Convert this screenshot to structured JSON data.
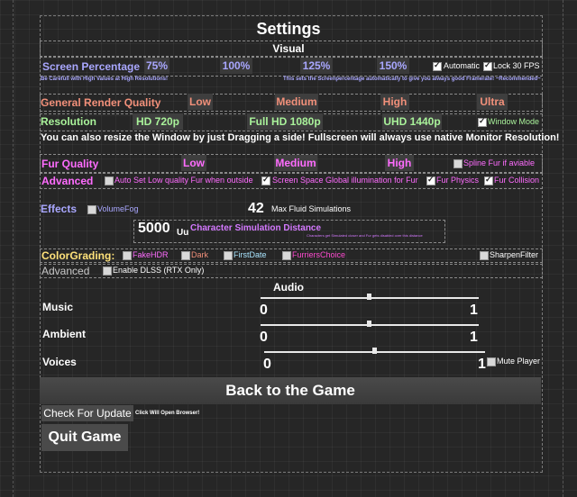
{
  "title": "Settings",
  "visual": {
    "header": "Visual",
    "screen_percentage": {
      "label": "Screen Percentage",
      "options": [
        "75%",
        "100%",
        "125%",
        "150%"
      ],
      "automatic": "Automatic",
      "lock30": "Lock 30 FPS",
      "warning": "Be Carefull with High Values at High Resolutions!",
      "auto_note": "This sets the Screenpercentage automatically to give you always good Framerate! ~Recommended~"
    },
    "render_quality": {
      "label": "General Render Quality",
      "options": [
        "Low",
        "Medium",
        "High",
        "Ultra"
      ]
    },
    "resolution": {
      "label": "Resolution",
      "options": [
        "HD 720p",
        "Full HD 1080p",
        "UHD 1440p"
      ],
      "window_mode": "Window Mode",
      "note": "You can also resize the Window by just Dragging a side! Fullscreen will always use native Monitor Resolution!"
    },
    "fur_quality": {
      "label": "Fur Quality",
      "options": [
        "Low",
        "Medium",
        "High"
      ],
      "spline": "Spline Fur if aviable"
    },
    "advanced": {
      "label": "Advanced",
      "auto_low": "Auto Set Low quality Fur when outside",
      "ssgi": "Screen Space Global illumination for Fur",
      "physics": "Fur Physics",
      "collision": "Fur Collision"
    },
    "effects": {
      "label": "Effects",
      "volumefog": "VolumeFog",
      "fluid_count": "42",
      "fluid_label": "Max Fluid Simulations"
    },
    "char_sim": {
      "value": "5000",
      "unit": "Uu",
      "label": "Character Simulation Distance",
      "note": "Characters get Simulated closer and Fur gets disabled over this distance"
    },
    "colorgrading": {
      "label": "ColorGrading:",
      "fakehdr": "FakeHDR",
      "dark": "Dark",
      "firstdate": "FirstDate",
      "furriers": "FurriersChoice",
      "sharpen": "SharpenFilter"
    },
    "advanced2": {
      "label": "Advanced",
      "dlss": "Enable DLSS (RTX Only)"
    }
  },
  "audio": {
    "header": "Audio",
    "music": {
      "label": "Music",
      "min": "0",
      "max": "1",
      "level": 0.5
    },
    "ambient": {
      "label": "Ambient",
      "min": "0",
      "max": "1",
      "level": 0.5
    },
    "voices": {
      "label": "Voices",
      "min": "0",
      "max": "1",
      "level": 0.5,
      "mute": "Mute Player"
    }
  },
  "buttons": {
    "back": "Back to the Game",
    "check_update": "Check For Update",
    "update_note": "Click Will Open Browser!",
    "quit": "Quit Game"
  },
  "colors": {
    "accent_blue": "#a9a7ff",
    "accent_salmon": "#f2907a",
    "accent_green": "#a9f29a",
    "accent_pink": "#ff6cff",
    "accent_yellow": "#ffe27a",
    "accent_grey": "#c9c9c9"
  }
}
